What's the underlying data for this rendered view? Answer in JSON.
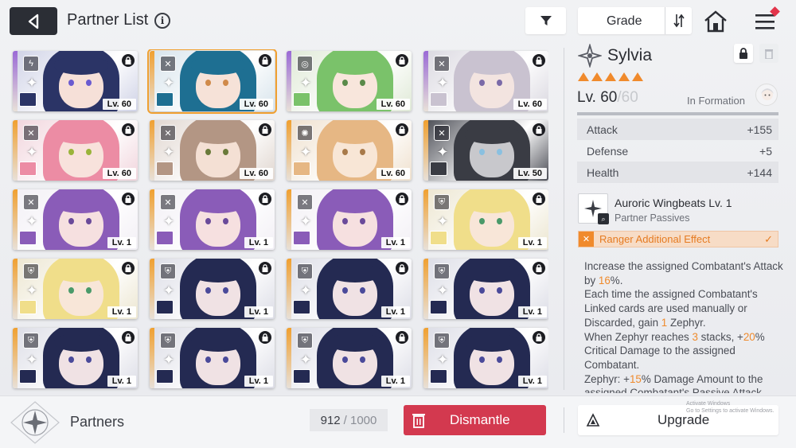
{
  "header": {
    "title": "Partner List",
    "info_glyph": "i",
    "sort_label": "Grade"
  },
  "cards": [
    {
      "level": "Lv. 60",
      "type": "bolt",
      "stripe": "#9a6ad6",
      "hair": "#2b3466",
      "skin": "#f6e0d8",
      "bg": "#cfd2e6",
      "eye": "#6a5bd0",
      "selected": false
    },
    {
      "level": "Lv. 60",
      "type": "swords",
      "stripe": "#f0a030",
      "hair": "#1e6f92",
      "skin": "#f6e2d8",
      "bg": "#d7e4ec",
      "eye": "#d08a4a",
      "selected": true
    },
    {
      "level": "Lv. 60",
      "type": "target",
      "stripe": "#9a6ad6",
      "hair": "#7ac26a",
      "skin": "#f8e6dc",
      "bg": "#dfe9d6",
      "eye": "#5a8a4a",
      "selected": false
    },
    {
      "level": "Lv. 60",
      "type": "swords",
      "stripe": "#9a6ad6",
      "hair": "#c9c2d0",
      "skin": "#f3e4e0",
      "bg": "#dad8e0",
      "eye": "#7a6aa8",
      "selected": false
    },
    {
      "level": "Lv. 60",
      "type": "swords",
      "stripe": "#f0a030",
      "hair": "#ec8ca4",
      "skin": "#f8e2dc",
      "bg": "#f1d4dc",
      "eye": "#9ab43a",
      "selected": false
    },
    {
      "level": "Lv. 60",
      "type": "swords",
      "stripe": "#f0a030",
      "hair": "#b39684",
      "skin": "#f4e0d4",
      "bg": "#e0d6cf",
      "eye": "#6a7a3a",
      "selected": false
    },
    {
      "level": "Lv. 60",
      "type": "sun",
      "stripe": "#f0a030",
      "hair": "#e6b784",
      "skin": "#f8e6d6",
      "bg": "#efe0cd",
      "eye": "#a87a4a",
      "selected": false
    },
    {
      "level": "Lv. 50",
      "type": "swords",
      "stripe": "#f0a030",
      "hair": "#3a3c44",
      "skin": "#c8c8cc",
      "bg": "#4a4c54",
      "eye": "#8ac0e0",
      "selected": false
    },
    {
      "level": "Lv. 1",
      "type": "swords",
      "stripe": "#f0a030",
      "hair": "#8a5cb8",
      "skin": "#f6e0e0",
      "bg": "#f2eff5",
      "eye": "#6a4a9a",
      "selected": false
    },
    {
      "level": "Lv. 1",
      "type": "swords",
      "stripe": "#f0a030",
      "hair": "#8a5cb8",
      "skin": "#f6e0e0",
      "bg": "#f2eff5",
      "eye": "#6a4a9a",
      "selected": false
    },
    {
      "level": "Lv. 1",
      "type": "swords",
      "stripe": "#f0a030",
      "hair": "#8a5cb8",
      "skin": "#f6e0e0",
      "bg": "#f2eff5",
      "eye": "#6a4a9a",
      "selected": false
    },
    {
      "level": "Lv. 1",
      "type": "shield",
      "stripe": "#f0a030",
      "hair": "#f0de8a",
      "skin": "#f8e6d8",
      "bg": "#ece6d0",
      "eye": "#4a9a6a",
      "selected": false
    },
    {
      "level": "Lv. 1",
      "type": "shield",
      "stripe": "#f0a030",
      "hair": "#f0de8a",
      "skin": "#f8e6d8",
      "bg": "#ece6d0",
      "eye": "#4a9a6a",
      "selected": false
    },
    {
      "level": "Lv. 1",
      "type": "shield",
      "stripe": "#f0a030",
      "hair": "#242a52",
      "skin": "#f0e2e4",
      "bg": "#dcdde6",
      "eye": "#4a4a9a",
      "selected": false
    },
    {
      "level": "Lv. 1",
      "type": "shield",
      "stripe": "#f0a030",
      "hair": "#242a52",
      "skin": "#f0e2e4",
      "bg": "#dcdde6",
      "eye": "#4a4a9a",
      "selected": false
    },
    {
      "level": "Lv. 1",
      "type": "shield",
      "stripe": "#f0a030",
      "hair": "#242a52",
      "skin": "#f0e2e4",
      "bg": "#dcdde6",
      "eye": "#4a4a9a",
      "selected": false
    },
    {
      "level": "Lv. 1",
      "type": "shield",
      "stripe": "#f0a030",
      "hair": "#242a52",
      "skin": "#f0e2e4",
      "bg": "#dcdde6",
      "eye": "#4a4a9a",
      "selected": false
    },
    {
      "level": "Lv. 1",
      "type": "shield",
      "stripe": "#f0a030",
      "hair": "#242a52",
      "skin": "#f0e2e4",
      "bg": "#dcdde6",
      "eye": "#4a4a9a",
      "selected": false
    },
    {
      "level": "Lv. 1",
      "type": "shield",
      "stripe": "#f0a030",
      "hair": "#242a52",
      "skin": "#f0e2e4",
      "bg": "#dcdde6",
      "eye": "#4a4a9a",
      "selected": false
    },
    {
      "level": "Lv. 1",
      "type": "shield",
      "stripe": "#f0a030",
      "hair": "#242a52",
      "skin": "#f0e2e4",
      "bg": "#dcdde6",
      "eye": "#4a4a9a",
      "selected": false
    }
  ],
  "detail": {
    "name": "Sylvia",
    "rarity_count": 5,
    "level_current": "Lv. 60",
    "level_max": "/60",
    "level_progress": 1.0,
    "formation_label": "In Formation",
    "stats": [
      {
        "label": "Attack",
        "value": "+155"
      },
      {
        "label": "Defense",
        "value": "+5"
      },
      {
        "label": "Health",
        "value": "+144"
      }
    ],
    "passive_name": "Auroric Wingbeats Lv. 1",
    "passive_sub": "Partner Passives",
    "ranger_label": "Ranger Additional Effect",
    "description": [
      [
        "Increase the assigned Combatant's Attack by ",
        "16",
        "%."
      ],
      [
        "Each time the assigned Combatant's Linked cards are used manually or Discarded, gain ",
        "1",
        " Zephyr."
      ],
      [
        "When Zephyr reaches ",
        "3",
        " stacks, +"
      ],
      [
        "",
        "20",
        "% Critical Damage to the assigned Combatant."
      ],
      [
        "Zephyr: +",
        "15",
        "% Damage Amount to the assigned Combatant's Passive Attack..."
      ]
    ]
  },
  "bottom": {
    "partners_label": "Partners",
    "capacity_current": "912",
    "capacity_max": "/ 1000",
    "dismantle_label": "Dismantle",
    "upgrade_label": "Upgrade",
    "watermark_line1": "Activate Windows",
    "watermark_line2": "Go to Settings to activate Windows."
  },
  "colors": {
    "accent_orange": "#f08a2c",
    "dismantle_red": "#d3394f",
    "dark_button": "#2b2e35"
  }
}
